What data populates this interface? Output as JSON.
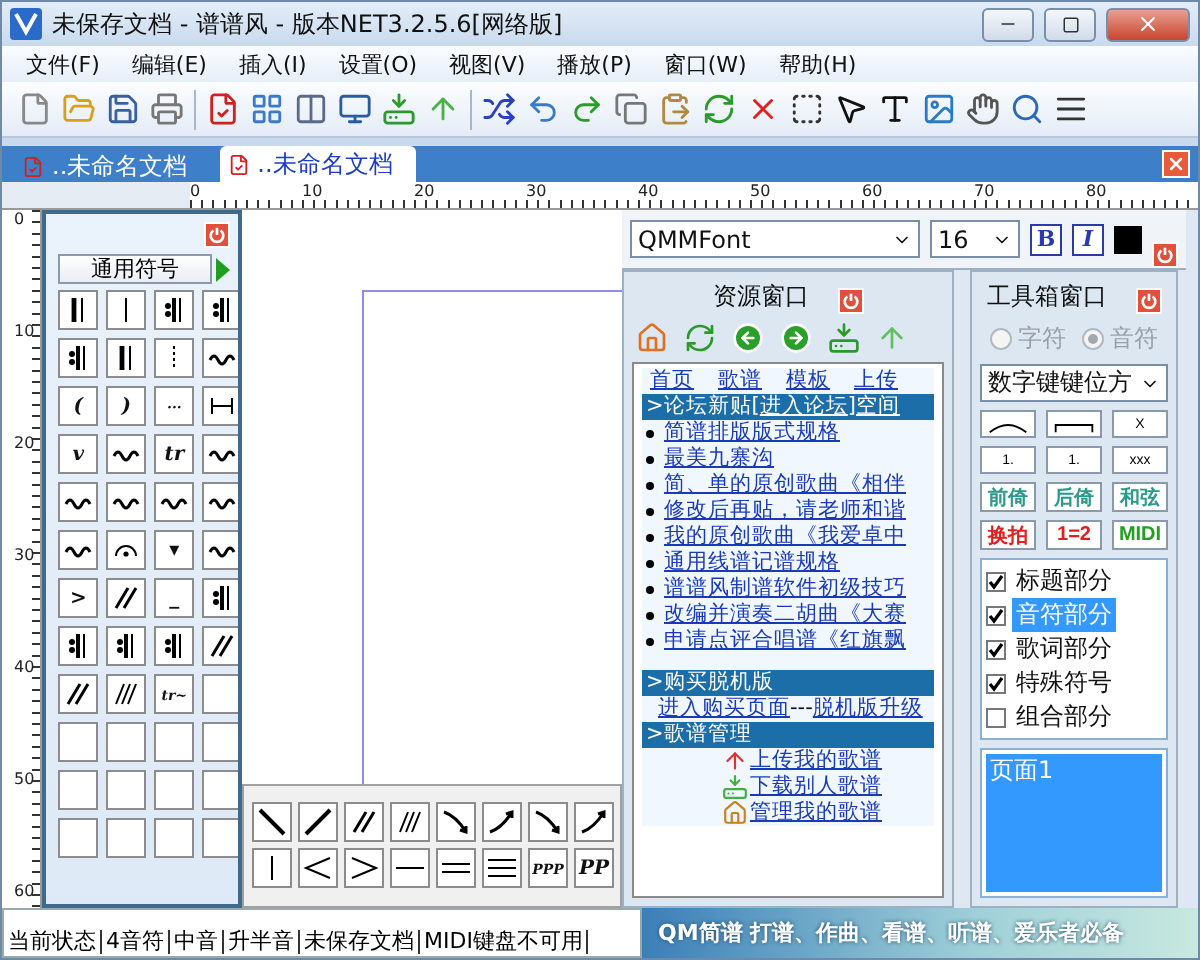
{
  "window": {
    "title": "未保存文档 - 谱谱风 - 版本NET3.2.5.6[网络版]"
  },
  "menu": [
    "文件(F)",
    "编辑(E)",
    "插入(I)",
    "设置(O)",
    "视图(V)",
    "播放(P)",
    "窗口(W)",
    "帮助(H)"
  ],
  "doc_tabs": [
    {
      "label": "..未命名文档",
      "selected": false
    },
    {
      "label": "..未命名文档",
      "selected": true
    }
  ],
  "ruler": {
    "horizontal": [
      "0",
      "10",
      "20",
      "30",
      "40",
      "50",
      "60",
      "70",
      "80"
    ],
    "vertical": [
      "0",
      "10",
      "20",
      "30",
      "40",
      "50",
      "60"
    ]
  },
  "symbol_panel": {
    "category": "通用符号",
    "symbols": [
      {
        "kind": "double-bar"
      },
      {
        "kind": "barline"
      },
      {
        "kind": "repeat"
      },
      {
        "kind": "repeat"
      },
      {
        "kind": "repeat"
      },
      {
        "kind": "double-bar"
      },
      {
        "kind": "dashed-bar"
      },
      {
        "kind": "ornament"
      },
      {
        "kind": "text",
        "label": "("
      },
      {
        "kind": "text",
        "label": ")"
      },
      {
        "kind": "text",
        "label": "···"
      },
      {
        "kind": "bracket"
      },
      {
        "kind": "text",
        "label": "v"
      },
      {
        "kind": "ornament"
      },
      {
        "kind": "text",
        "label": "tr"
      },
      {
        "kind": "ornament"
      },
      {
        "kind": "ornament"
      },
      {
        "kind": "ornament"
      },
      {
        "kind": "ornament"
      },
      {
        "kind": "ornament"
      },
      {
        "kind": "ornament"
      },
      {
        "kind": "fermata"
      },
      {
        "kind": "text",
        "label": "▾"
      },
      {
        "kind": "ornament"
      },
      {
        "kind": "text",
        "label": ">"
      },
      {
        "kind": "slash"
      },
      {
        "kind": "text",
        "label": "_"
      },
      {
        "kind": "repeat"
      },
      {
        "kind": "repeat"
      },
      {
        "kind": "repeat"
      },
      {
        "kind": "repeat"
      },
      {
        "kind": "slash"
      },
      {
        "kind": "slash"
      },
      {
        "kind": "hatch"
      },
      {
        "kind": "text",
        "label": "tr~"
      },
      {
        "kind": "empty"
      },
      {
        "kind": "empty"
      },
      {
        "kind": "empty"
      },
      {
        "kind": "empty"
      },
      {
        "kind": "empty"
      },
      {
        "kind": "empty"
      },
      {
        "kind": "empty"
      },
      {
        "kind": "empty"
      },
      {
        "kind": "empty"
      },
      {
        "kind": "empty"
      },
      {
        "kind": "empty"
      },
      {
        "kind": "empty"
      },
      {
        "kind": "empty"
      }
    ]
  },
  "palette": [
    {
      "kind": "line-down"
    },
    {
      "kind": "line-up"
    },
    {
      "kind": "slash"
    },
    {
      "kind": "hatch"
    },
    {
      "kind": "arrow-down"
    },
    {
      "kind": "arrow-up"
    },
    {
      "kind": "arrow-down"
    },
    {
      "kind": "arrow-up"
    },
    {
      "kind": "barline"
    },
    {
      "kind": "cresc"
    },
    {
      "kind": "decresc"
    },
    {
      "kind": "single-line"
    },
    {
      "kind": "double-line"
    },
    {
      "kind": "triple-line"
    },
    {
      "kind": "text",
      "label": "PPP"
    },
    {
      "kind": "text",
      "label": "PP"
    }
  ],
  "font_bar": {
    "font": "QMMFont",
    "size": "16",
    "bold": "B",
    "italic": "I",
    "color": "#000000"
  },
  "resource_window": {
    "title": "资源窗口",
    "nav": [
      "首页",
      "歌谱",
      "模板",
      "上传"
    ],
    "forum": [
      {
        "kind": "text",
        "text": ">论坛新贴["
      },
      {
        "kind": "link",
        "text": "进入论坛"
      },
      {
        "kind": "text",
        "text": "]"
      },
      {
        "kind": "link",
        "text": "空间"
      }
    ],
    "posts": [
      "简谱排版版式规格",
      "最美九寨沟",
      "简、单的原创歌曲《相伴",
      "修改后再贴，请老师和谐",
      "我的原创歌曲《我爱卓中",
      "通用线谱记谱规格",
      "谱谱风制谱软件初级技巧",
      "改编并演奏二胡曲《大赛",
      "申请点评合唱谱《红旗飘"
    ],
    "buy": {
      "title": ">购买脱机版",
      "parts": [
        {
          "kind": "link",
          "text": "进入购买页面"
        },
        {
          "kind": "text",
          "text": "---"
        },
        {
          "kind": "link",
          "text": "脱机版升级"
        }
      ]
    },
    "manage": {
      "title": ">歌谱管理",
      "links": [
        {
          "kind": "upload",
          "text": "上传我的歌谱"
        },
        {
          "kind": "download",
          "text": "下载别人歌谱"
        },
        {
          "kind": "home",
          "text": "管理我的歌谱"
        }
      ]
    }
  },
  "toolbox": {
    "title": "工具箱窗口",
    "modes": [
      {
        "label": "字符",
        "selected": false,
        "disabled": true
      },
      {
        "label": "音符",
        "selected": true,
        "disabled": true
      }
    ],
    "layout": "数字键键位方",
    "line_buttons": [
      {
        "kind": "slur"
      },
      {
        "kind": "tie"
      },
      {
        "kind": "tuplet",
        "label": "X"
      },
      {
        "kind": "volta",
        "label": "1."
      },
      {
        "kind": "volta",
        "label": "1."
      },
      {
        "kind": "volta",
        "label": "xxx"
      }
    ],
    "text_buttons": [
      {
        "label": "前倚",
        "color": "#2a9a8a"
      },
      {
        "label": "后倚",
        "color": "#2a9a8a"
      },
      {
        "label": "和弦",
        "color": "#2a9a8a"
      },
      {
        "label": "换拍",
        "color": "#e02020"
      },
      {
        "label": "1=2",
        "color": "#e02020"
      },
      {
        "label": "MIDI",
        "color": "#20a020"
      }
    ],
    "parts": [
      {
        "label": "标题部分",
        "checked": true,
        "selected": false
      },
      {
        "label": "音符部分",
        "checked": true,
        "selected": true
      },
      {
        "label": "歌词部分",
        "checked": true,
        "selected": false
      },
      {
        "label": "特殊符号",
        "checked": true,
        "selected": false
      },
      {
        "label": "组合部分",
        "checked": false,
        "selected": false
      }
    ],
    "pages": [
      {
        "label": "页面1",
        "selected": true
      }
    ]
  },
  "status_bar": [
    "当前状态",
    "4音符",
    "中音",
    "升半音",
    "未保存文档",
    "MIDI键盘不可用"
  ],
  "banner": "QM简谱 打谱、作曲、看谱、听谱、爱乐者必备"
}
